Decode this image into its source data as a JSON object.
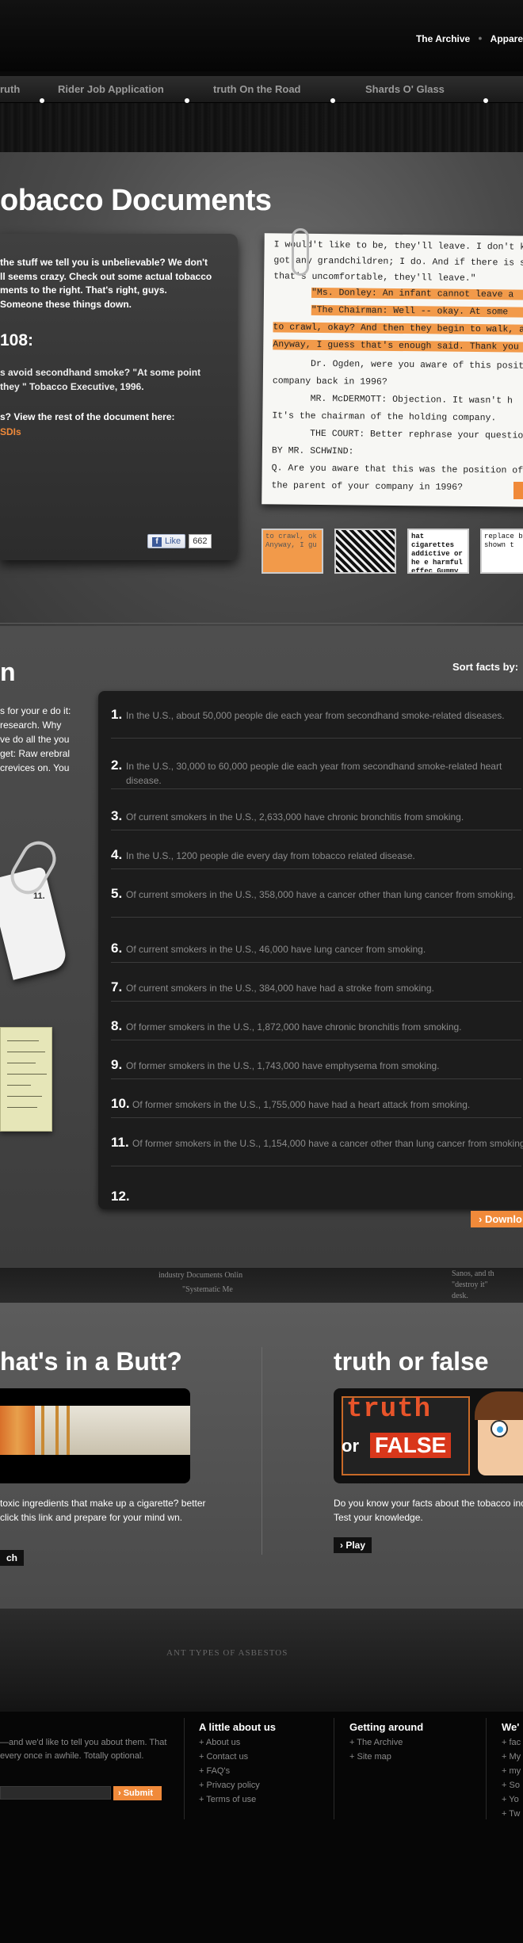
{
  "topnav": {
    "links": [
      "The Archive",
      "Appare"
    ]
  },
  "mainnav": {
    "items": [
      "ruth",
      "Rider Job Application",
      "truth On the Road",
      "Shards O' Glass"
    ]
  },
  "documents": {
    "title": "obacco Documents",
    "intro": "the stuff we tell you is unbelievable? We don't ll seems crazy. Check out some actual tobacco ments to the right. That's right, guys. Someone these things down.",
    "doc_number": "108:",
    "quote": "s avoid secondhand smoke? \"At some point they \" Tobacco Executive, 1996.",
    "view_rest": "s? View the rest of the document here:",
    "link": "SDIs",
    "like_label": "Like",
    "like_count": "662",
    "paper_lines": [
      "I would't like to be, they'll leave.  I don't k",
      "got any grandchildren; I do.  And if there is sm",
      "that's uncomfortable, they'll leave.\"",
      "\"Ms. Donley: An infant cannot leave a",
      "\"The Chairman:  Well -- okay.  At some",
      "to crawl, okay?  And then they begin to walk, an",
      "Anyway, I guess that's enough said.  Thank you y",
      "Dr. Ogden, were you aware of this posit",
      "company back in 1996?",
      "MR. McDERMOTT:  Objection.  It wasn't h",
      "It's the chairman of the holding company.",
      "THE COURT:  Better rephrase your questio",
      "BY MR. SCHWIND:",
      "Q.  Are you aware that this was the position of",
      "the parent of your company in 1996?"
    ],
    "thumbs": [
      {
        "text": "to crawl, ok Anyway, I gu"
      },
      {
        "text": ""
      },
      {
        "text": "hat cigarettes addictive or he e harmful effec Gummy Bears Bears. I like G"
      },
      {
        "text": "replace be shown t"
      }
    ]
  },
  "facts": {
    "title": "n",
    "sort_label": "Sort facts by:",
    "side_text": "s for your e do it: research. Why ve do all the you get: Raw erebral crevices on. You",
    "torn_number": "11.",
    "items": [
      {
        "num": "1.",
        "text": "In the U.S., about 50,000 people die each year from secondhand smoke-related diseases."
      },
      {
        "num": "2.",
        "text": "In the U.S., 30,000 to 60,000 people die each year from secondhand smoke-related heart disease."
      },
      {
        "num": "3.",
        "text": "Of current smokers in the U.S., 2,633,000 have chronic bronchitis from smoking."
      },
      {
        "num": "4.",
        "text": "In the U.S., 1200 people die every day from tobacco related disease."
      },
      {
        "num": "5.",
        "text": "Of current smokers in the U.S., 358,000 have a cancer other than lung cancer from smoking."
      },
      {
        "num": "6.",
        "text": "Of current smokers in the U.S., 46,000 have lung cancer from smoking."
      },
      {
        "num": "7.",
        "text": "Of current smokers in the U.S., 384,000 have had a stroke from smoking."
      },
      {
        "num": "8.",
        "text": "Of former smokers in the U.S., 1,872,000 have chronic bronchitis from smoking."
      },
      {
        "num": "9.",
        "text": "Of former smokers in the U.S., 1,743,000 have emphysema from smoking."
      },
      {
        "num": "10.",
        "text": "Of former smokers in the U.S., 1,755,000 have had a heart attack from smoking."
      },
      {
        "num": "11.",
        "text": "Of former smokers in the U.S., 1,154,000 have a cancer other than lung cancer from smoking."
      },
      {
        "num": "12.",
        "text": ""
      }
    ],
    "download_label": "› Downlo"
  },
  "doc_strip": {
    "texts": [
      "industry Documents Onlin",
      "\"Systematic Me",
      "Sanos, and th",
      "\"destroy it\"",
      "desk."
    ]
  },
  "promos": {
    "butt": {
      "title": "hat's in a Butt?",
      "desc": "toxic ingredients that make up a cigarette? better click this link and prepare for your mind wn.",
      "button": "ch"
    },
    "truth_false": {
      "title": "truth or false",
      "truth_text": "truth",
      "or_text": "or",
      "false_text": "FALSE",
      "desc": "Do you know your facts about the tobacco inc Test your knowledge.",
      "button": "› Play"
    }
  },
  "doc_footer": {
    "text": "ANT TYPES OF ASBESTOS"
  },
  "footer": {
    "intro": "—and we'd like to tell you about them. That every once in awhile. Totally optional.",
    "submit": "› Submit",
    "about": {
      "heading": "A little about us",
      "links": [
        "+ About us",
        "+ Contact us",
        "+ FAQ's",
        "+ Privacy policy",
        "+ Terms of use"
      ]
    },
    "around": {
      "heading": "Getting around",
      "links": [
        "+ The Archive",
        "+ Site map"
      ]
    },
    "more": {
      "heading": "We'",
      "links": [
        "+ fac",
        "+ My",
        "+ my",
        "+ So",
        "+ Yo",
        "+ Tw"
      ]
    }
  },
  "colors": {
    "accent": "#f08a3a",
    "page_bg": "#4a4a4a",
    "panel_bg": "#1c1c1c",
    "highlight": "#f29a4a"
  }
}
